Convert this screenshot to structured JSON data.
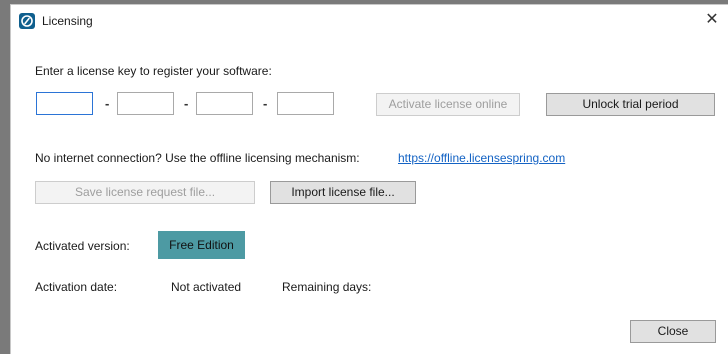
{
  "window": {
    "title": "Licensing",
    "close_glyph": "✕"
  },
  "prompt": "Enter a license key to register your software:",
  "license_key": {
    "segments": [
      "",
      "",
      "",
      ""
    ],
    "separator": "-"
  },
  "buttons": {
    "activate_online": "Activate license online",
    "unlock_trial": "Unlock trial period",
    "save_request": "Save license request file...",
    "import_license": "Import license file...",
    "close": "Close"
  },
  "offline": {
    "text": "No internet connection? Use the offline licensing mechanism:",
    "link": "https://offline.licensespring.com"
  },
  "status": {
    "version_label": "Activated version:",
    "version_value": "Free Edition",
    "date_label": "Activation date:",
    "date_value": "Not activated",
    "remaining_label": "Remaining days:",
    "remaining_value": ""
  },
  "colors": {
    "badge": "#4d9aa3",
    "link": "#1463c4",
    "focus_border": "#2b74d6",
    "app_icon": "#0f5f8e"
  },
  "icons": {
    "app": "licensing-app-icon",
    "close": "close-icon"
  }
}
